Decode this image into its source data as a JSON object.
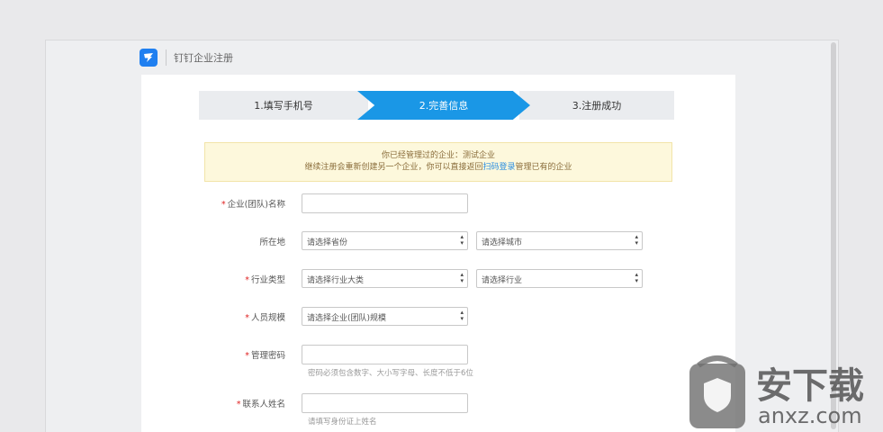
{
  "window": {
    "title": "钉钉企业注册"
  },
  "steps": [
    {
      "label": "1.填写手机号",
      "state": "done"
    },
    {
      "label": "2.完善信息",
      "state": "active"
    },
    {
      "label": "3.注册成功",
      "state": "pending"
    }
  ],
  "notice": {
    "line1": "你已经管理过的企业：测试企业",
    "line2_pre": "继续注册会重新创建另一个企业，你可以直接返回",
    "line2_link": "扫码登录",
    "line2_post": "管理已有的企业"
  },
  "form": {
    "company_name": {
      "label": "企业(团队)名称",
      "required": true,
      "value": ""
    },
    "location": {
      "label": "所在地",
      "required": false,
      "province_placeholder": "请选择省份",
      "city_placeholder": "请选择城市"
    },
    "industry": {
      "label": "行业类型",
      "required": true,
      "category_placeholder": "请选择行业大类",
      "industry_placeholder": "请选择行业"
    },
    "staff_size": {
      "label": "人员规模",
      "required": true,
      "placeholder": "请选择企业(团队)规模"
    },
    "admin_password": {
      "label": "管理密码",
      "required": true,
      "value": "",
      "hint": "密码必须包含数字、大小写字母、长度不低于6位"
    },
    "contact_name": {
      "label": "联系人姓名",
      "required": true,
      "value": "",
      "hint": "请填写身份证上姓名"
    }
  },
  "watermark": {
    "text": "安下载",
    "domain": "anxz.com"
  },
  "colors": {
    "accent": "#1a97e6",
    "required": "#e02424",
    "notice_bg": "#fdf8dc",
    "link": "#2b8de0"
  }
}
